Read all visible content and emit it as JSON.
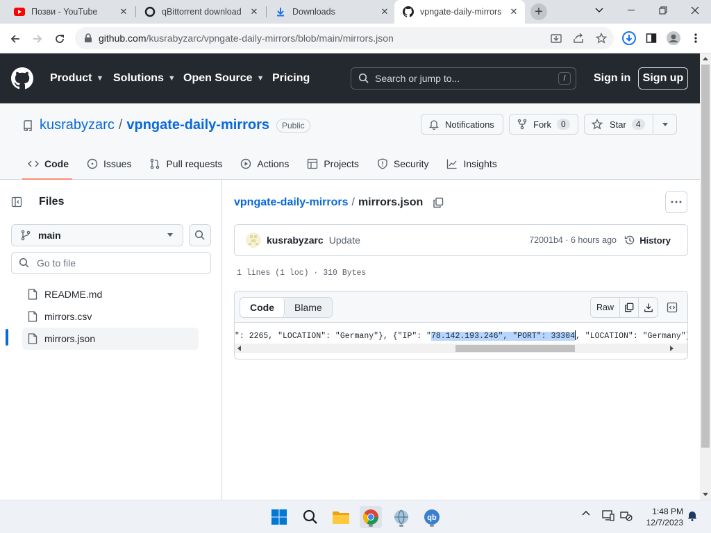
{
  "browser": {
    "tabs": [
      {
        "title": "Позви - YouTube",
        "icon": "youtube-icon"
      },
      {
        "title": "qBittorrent download",
        "icon": "qbittorrent-icon"
      },
      {
        "title": "Downloads",
        "icon": "download-icon"
      },
      {
        "title": "vpngate-daily-mirrors",
        "icon": "github-icon"
      }
    ],
    "url_host": "github.com",
    "url_path": "/kusrabyzarc/vpngate-daily-mirrors/blob/main/mirrors.json"
  },
  "gh_header": {
    "nav": [
      "Product",
      "Solutions",
      "Open Source",
      "Pricing"
    ],
    "search_placeholder": "Search or jump to...",
    "search_key": "/",
    "sign_in": "Sign in",
    "sign_up": "Sign up"
  },
  "repo": {
    "owner": "kusrabyzarc",
    "name": "vpngate-daily-mirrors",
    "visibility": "Public",
    "notifications_label": "Notifications",
    "fork_label": "Fork",
    "fork_count": "0",
    "star_label": "Star",
    "star_count": "4",
    "tabs": [
      "Code",
      "Issues",
      "Pull requests",
      "Actions",
      "Projects",
      "Security",
      "Insights"
    ]
  },
  "sidebar": {
    "title": "Files",
    "branch": "main",
    "goto_placeholder": "Go to file",
    "files": [
      "README.md",
      "mirrors.csv",
      "mirrors.json"
    ]
  },
  "file": {
    "breadcrumb_repo": "vpngate-daily-mirrors",
    "breadcrumb_file": "mirrors.json",
    "commit_author": "kusrabyzarc",
    "commit_message": "Update",
    "commit_sha_time": "72001b4 · 6 hours ago",
    "history_label": "History",
    "meta": "1 lines (1 loc) · 310 Bytes",
    "code_tab": "Code",
    "blame_tab": "Blame",
    "raw_label": "Raw",
    "code_before": "\": 2265, \"LOCATION\": \"Germany\"}, {\"IP\": \"",
    "code_selected": "78.142.193.246\", \"PORT\": 33304",
    "code_after": ", \"LOCATION\": \"Germany\"}, {\""
  },
  "taskbar": {
    "time": "1:48 PM",
    "date": "12/7/2023"
  }
}
